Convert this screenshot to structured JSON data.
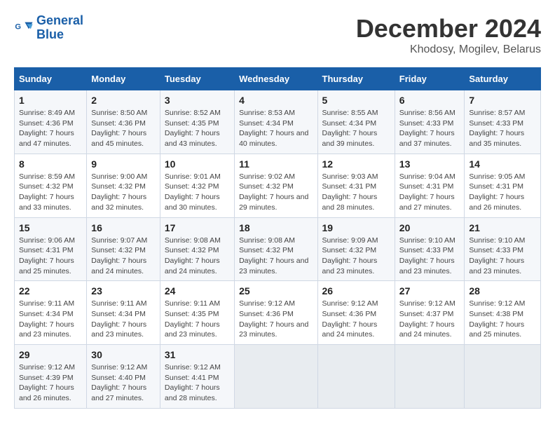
{
  "logo": {
    "line1": "General",
    "line2": "Blue"
  },
  "title": "December 2024",
  "subtitle": "Khodosy, Mogilev, Belarus",
  "weekdays": [
    "Sunday",
    "Monday",
    "Tuesday",
    "Wednesday",
    "Thursday",
    "Friday",
    "Saturday"
  ],
  "weeks": [
    [
      {
        "day": "1",
        "sunrise": "Sunrise: 8:49 AM",
        "sunset": "Sunset: 4:36 PM",
        "daylight": "Daylight: 7 hours and 47 minutes."
      },
      {
        "day": "2",
        "sunrise": "Sunrise: 8:50 AM",
        "sunset": "Sunset: 4:36 PM",
        "daylight": "Daylight: 7 hours and 45 minutes."
      },
      {
        "day": "3",
        "sunrise": "Sunrise: 8:52 AM",
        "sunset": "Sunset: 4:35 PM",
        "daylight": "Daylight: 7 hours and 43 minutes."
      },
      {
        "day": "4",
        "sunrise": "Sunrise: 8:53 AM",
        "sunset": "Sunset: 4:34 PM",
        "daylight": "Daylight: 7 hours and 40 minutes."
      },
      {
        "day": "5",
        "sunrise": "Sunrise: 8:55 AM",
        "sunset": "Sunset: 4:34 PM",
        "daylight": "Daylight: 7 hours and 39 minutes."
      },
      {
        "day": "6",
        "sunrise": "Sunrise: 8:56 AM",
        "sunset": "Sunset: 4:33 PM",
        "daylight": "Daylight: 7 hours and 37 minutes."
      },
      {
        "day": "7",
        "sunrise": "Sunrise: 8:57 AM",
        "sunset": "Sunset: 4:33 PM",
        "daylight": "Daylight: 7 hours and 35 minutes."
      }
    ],
    [
      {
        "day": "8",
        "sunrise": "Sunrise: 8:59 AM",
        "sunset": "Sunset: 4:32 PM",
        "daylight": "Daylight: 7 hours and 33 minutes."
      },
      {
        "day": "9",
        "sunrise": "Sunrise: 9:00 AM",
        "sunset": "Sunset: 4:32 PM",
        "daylight": "Daylight: 7 hours and 32 minutes."
      },
      {
        "day": "10",
        "sunrise": "Sunrise: 9:01 AM",
        "sunset": "Sunset: 4:32 PM",
        "daylight": "Daylight: 7 hours and 30 minutes."
      },
      {
        "day": "11",
        "sunrise": "Sunrise: 9:02 AM",
        "sunset": "Sunset: 4:32 PM",
        "daylight": "Daylight: 7 hours and 29 minutes."
      },
      {
        "day": "12",
        "sunrise": "Sunrise: 9:03 AM",
        "sunset": "Sunset: 4:31 PM",
        "daylight": "Daylight: 7 hours and 28 minutes."
      },
      {
        "day": "13",
        "sunrise": "Sunrise: 9:04 AM",
        "sunset": "Sunset: 4:31 PM",
        "daylight": "Daylight: 7 hours and 27 minutes."
      },
      {
        "day": "14",
        "sunrise": "Sunrise: 9:05 AM",
        "sunset": "Sunset: 4:31 PM",
        "daylight": "Daylight: 7 hours and 26 minutes."
      }
    ],
    [
      {
        "day": "15",
        "sunrise": "Sunrise: 9:06 AM",
        "sunset": "Sunset: 4:31 PM",
        "daylight": "Daylight: 7 hours and 25 minutes."
      },
      {
        "day": "16",
        "sunrise": "Sunrise: 9:07 AM",
        "sunset": "Sunset: 4:32 PM",
        "daylight": "Daylight: 7 hours and 24 minutes."
      },
      {
        "day": "17",
        "sunrise": "Sunrise: 9:08 AM",
        "sunset": "Sunset: 4:32 PM",
        "daylight": "Daylight: 7 hours and 24 minutes."
      },
      {
        "day": "18",
        "sunrise": "Sunrise: 9:08 AM",
        "sunset": "Sunset: 4:32 PM",
        "daylight": "Daylight: 7 hours and 23 minutes."
      },
      {
        "day": "19",
        "sunrise": "Sunrise: 9:09 AM",
        "sunset": "Sunset: 4:32 PM",
        "daylight": "Daylight: 7 hours and 23 minutes."
      },
      {
        "day": "20",
        "sunrise": "Sunrise: 9:10 AM",
        "sunset": "Sunset: 4:33 PM",
        "daylight": "Daylight: 7 hours and 23 minutes."
      },
      {
        "day": "21",
        "sunrise": "Sunrise: 9:10 AM",
        "sunset": "Sunset: 4:33 PM",
        "daylight": "Daylight: 7 hours and 23 minutes."
      }
    ],
    [
      {
        "day": "22",
        "sunrise": "Sunrise: 9:11 AM",
        "sunset": "Sunset: 4:34 PM",
        "daylight": "Daylight: 7 hours and 23 minutes."
      },
      {
        "day": "23",
        "sunrise": "Sunrise: 9:11 AM",
        "sunset": "Sunset: 4:34 PM",
        "daylight": "Daylight: 7 hours and 23 minutes."
      },
      {
        "day": "24",
        "sunrise": "Sunrise: 9:11 AM",
        "sunset": "Sunset: 4:35 PM",
        "daylight": "Daylight: 7 hours and 23 minutes."
      },
      {
        "day": "25",
        "sunrise": "Sunrise: 9:12 AM",
        "sunset": "Sunset: 4:36 PM",
        "daylight": "Daylight: 7 hours and 23 minutes."
      },
      {
        "day": "26",
        "sunrise": "Sunrise: 9:12 AM",
        "sunset": "Sunset: 4:36 PM",
        "daylight": "Daylight: 7 hours and 24 minutes."
      },
      {
        "day": "27",
        "sunrise": "Sunrise: 9:12 AM",
        "sunset": "Sunset: 4:37 PM",
        "daylight": "Daylight: 7 hours and 24 minutes."
      },
      {
        "day": "28",
        "sunrise": "Sunrise: 9:12 AM",
        "sunset": "Sunset: 4:38 PM",
        "daylight": "Daylight: 7 hours and 25 minutes."
      }
    ],
    [
      {
        "day": "29",
        "sunrise": "Sunrise: 9:12 AM",
        "sunset": "Sunset: 4:39 PM",
        "daylight": "Daylight: 7 hours and 26 minutes."
      },
      {
        "day": "30",
        "sunrise": "Sunrise: 9:12 AM",
        "sunset": "Sunset: 4:40 PM",
        "daylight": "Daylight: 7 hours and 27 minutes."
      },
      {
        "day": "31",
        "sunrise": "Sunrise: 9:12 AM",
        "sunset": "Sunset: 4:41 PM",
        "daylight": "Daylight: 7 hours and 28 minutes."
      },
      null,
      null,
      null,
      null
    ]
  ]
}
